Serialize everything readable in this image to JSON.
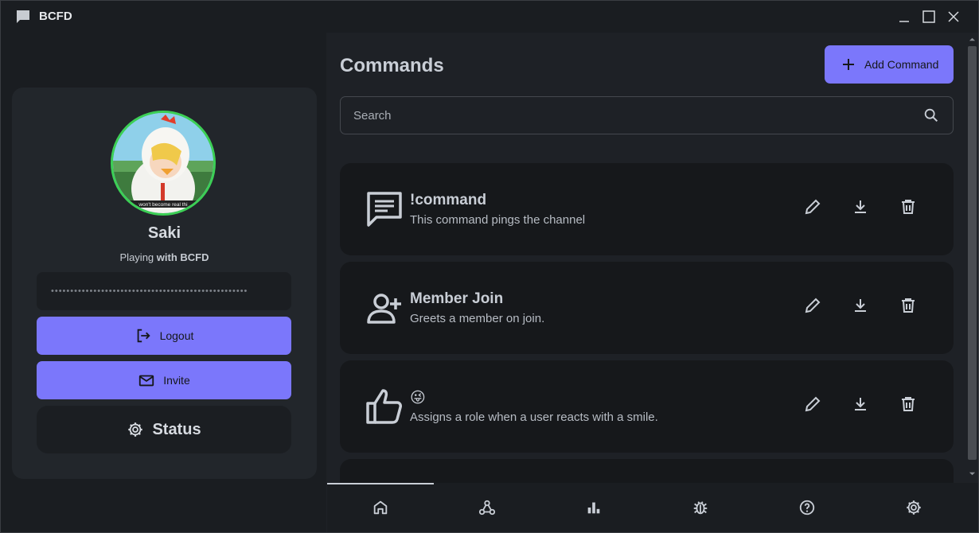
{
  "window": {
    "title": "BCFD",
    "icons": {
      "app": "chat-bubble-icon",
      "minimize": "minimize-icon",
      "maximize": "maximize-icon",
      "close": "close-icon"
    }
  },
  "profile": {
    "name": "Saki",
    "status_prefix": "Playing ",
    "status_bold": "with BCFD",
    "token_masked": "•••••••••••••••••••••••••••••••••••••••••••••••••••",
    "logout_label": "Logout",
    "invite_label": "Invite",
    "status_label": "Status",
    "avatar_caption": "won't become real thi"
  },
  "main": {
    "title": "Commands",
    "add_button_label": "Add Command",
    "search_placeholder": "Search",
    "commands": [
      {
        "icon": "message-icon",
        "name": "!command",
        "description": "This command pings the channel"
      },
      {
        "icon": "user-add-icon",
        "name": "Member Join",
        "description": "Greets a member on join."
      },
      {
        "icon": "thumbs-up-icon",
        "name": "😜",
        "description": "Assigns a role when a user reacts with a smile."
      }
    ],
    "actions": [
      "edit-icon",
      "download-icon",
      "delete-icon"
    ]
  },
  "bottom_nav": {
    "items": [
      "home-icon",
      "webhook-icon",
      "stats-icon",
      "bug-icon",
      "help-icon",
      "settings-icon"
    ],
    "active": 0
  },
  "colors": {
    "accent": "#7b77fb",
    "avatar_ring": "#3ccf55",
    "background": "#1e2126",
    "card": "#16181b"
  }
}
